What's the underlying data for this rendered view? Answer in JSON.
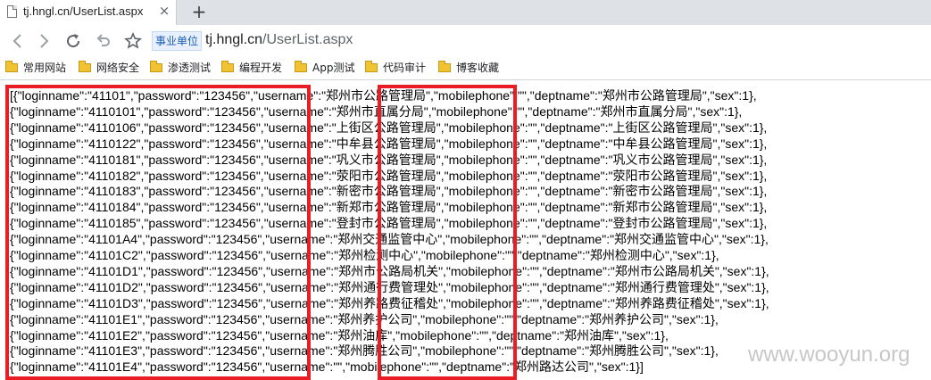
{
  "tab": {
    "title": "tj.hngl.cn/UserList.aspx",
    "close_label": "×",
    "new_tab_label": "+"
  },
  "toolbar": {
    "security_label": "事业单位",
    "url_host": "tj.hngl.cn",
    "url_path": "/UserList.aspx"
  },
  "bookmarks": [
    {
      "label": "常用网站"
    },
    {
      "label": "网络安全"
    },
    {
      "label": "渗透测试"
    },
    {
      "label": "编程开发"
    },
    {
      "label": "App测试"
    },
    {
      "label": "代码审计"
    },
    {
      "label": "博客收藏"
    }
  ],
  "content_lines": [
    "[{\"loginname\":\"41101\",\"password\":\"123456\",\"username\":\"郑州市公路管理局\",\"mobilephone\":\"\",\"deptname\":\"郑州市公路管理局\",\"sex\":1},",
    "{\"loginname\":\"4110101\",\"password\":\"123456\",\"username\":\"郑州市直属分局\",\"mobilephone\":\"\",\"deptname\":\"郑州市直属分局\",\"sex\":1},",
    "{\"loginname\":\"4110106\",\"password\":\"123456\",\"username\":\"上街区公路管理局\",\"mobilephone\":\"\",\"deptname\":\"上街区公路管理局\",\"sex\":1},",
    "{\"loginname\":\"4110122\",\"password\":\"123456\",\"username\":\"中牟县公路管理局\",\"mobilephone\":\"\",\"deptname\":\"中牟县公路管理局\",\"sex\":1},",
    "{\"loginname\":\"4110181\",\"password\":\"123456\",\"username\":\"巩义市公路管理局\",\"mobilephone\":\"\",\"deptname\":\"巩义市公路管理局\",\"sex\":1},",
    "{\"loginname\":\"4110182\",\"password\":\"123456\",\"username\":\"荥阳市公路管理局\",\"mobilephone\":\"\",\"deptname\":\"荥阳市公路管理局\",\"sex\":1},",
    "{\"loginname\":\"4110183\",\"password\":\"123456\",\"username\":\"新密市公路管理局\",\"mobilephone\":\"\",\"deptname\":\"新密市公路管理局\",\"sex\":1},",
    "{\"loginname\":\"4110184\",\"password\":\"123456\",\"username\":\"新郑市公路管理局\",\"mobilephone\":\"\",\"deptname\":\"新郑市公路管理局\",\"sex\":1},",
    "{\"loginname\":\"4110185\",\"password\":\"123456\",\"username\":\"登封市公路管理局\",\"mobilephone\":\"\",\"deptname\":\"登封市公路管理局\",\"sex\":1},",
    "{\"loginname\":\"41101A4\",\"password\":\"123456\",\"username\":\"郑州交通监管中心\",\"mobilephone\":\"\",\"deptname\":\"郑州交通监管中心\",\"sex\":1},",
    "{\"loginname\":\"41101C2\",\"password\":\"123456\",\"username\":\"郑州检测中心\",\"mobilephone\":\"\",\"deptname\":\"郑州检测中心\",\"sex\":1},",
    "{\"loginname\":\"41101D1\",\"password\":\"123456\",\"username\":\"郑州市公路局机关\",\"mobilephone\":\"\",\"deptname\":\"郑州市公路局机关\",\"sex\":1},",
    "{\"loginname\":\"41101D2\",\"password\":\"123456\",\"username\":\"郑州通行费管理处\",\"mobilephone\":\"\",\"deptname\":\"郑州通行费管理处\",\"sex\":1},",
    "{\"loginname\":\"41101D3\",\"password\":\"123456\",\"username\":\"郑州养路费征稽处\",\"mobilephone\":\"\",\"deptname\":\"郑州养路费征稽处\",\"sex\":1},",
    "{\"loginname\":\"41101E1\",\"password\":\"123456\",\"username\":\"郑州养护公司\",\"mobilephone\":\"\",\"deptname\":\"郑州养护公司\",\"sex\":1},",
    "{\"loginname\":\"41101E2\",\"password\":\"123456\",\"username\":\"郑州油库\",\"mobilephone\":\"\",\"deptname\":\"郑州油库\",\"sex\":1},",
    "{\"loginname\":\"41101E3\",\"password\":\"123456\",\"username\":\"郑州腾胜公司\",\"mobilephone\":\"\",\"deptname\":\"郑州腾胜公司\",\"sex\":1},",
    "{\"loginname\":\"41101E4\",\"password\":\"123456\",\"username\":\"\",\"mobilephone\":\"\",\"deptname\":\"郑州路达公司\",\"sex\":1}]"
  ],
  "watermark": "www.wooyun.org",
  "colors": {
    "highlight_box": "#ea1c24",
    "tab_strip": "#dee1e6",
    "folder": "#f1c232"
  }
}
